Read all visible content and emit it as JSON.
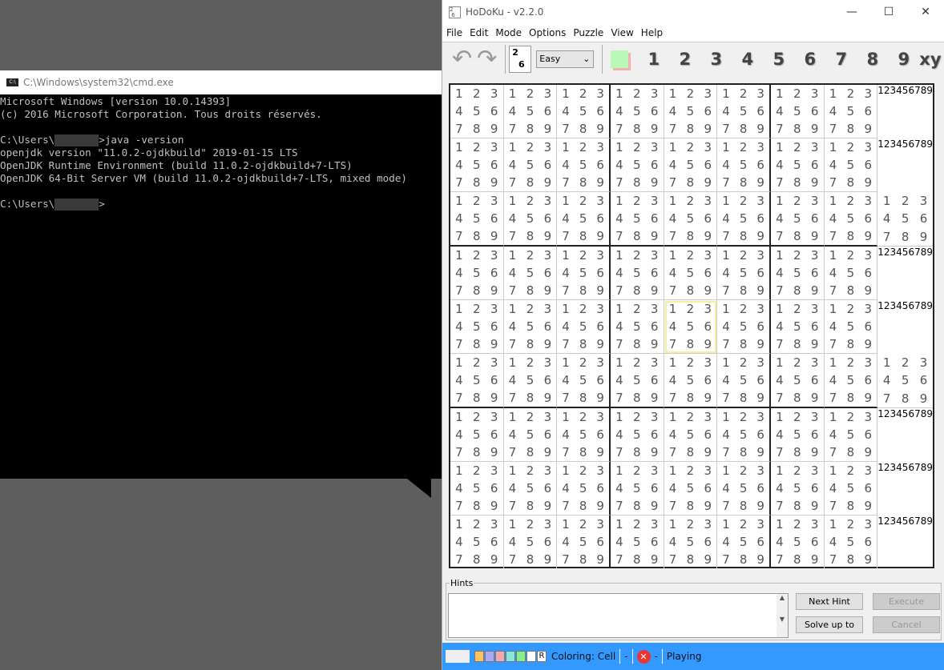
{
  "cmd": {
    "title": "C:\\Windows\\system32\\cmd.exe",
    "icon": "cmd-icon",
    "lines": [
      "Microsoft Windows [version 10.0.14393]",
      "(c) 2016 Microsoft Corporation. Tous droits réservés.",
      "",
      "C:\\Users\\",
      "openjdk version \"11.0.2-ojdkbuild\" 2019-01-15 LTS",
      "OpenJDK Runtime Environment (build 11.0.2-ojdkbuild+7-LTS)",
      "OpenJDK 64-Bit Server VM (build 11.0.2-ojdkbuild+7-LTS, mixed mode)",
      "",
      "C:\\Users\\"
    ],
    "cmd_suffix": ">java -version",
    "prompt_suffix": ">"
  },
  "app": {
    "title": "HoDoKu - v2.2.0",
    "menu": [
      "File",
      "Edit",
      "Mode",
      "Options",
      "Puzzle",
      "View",
      "Help"
    ],
    "difficulty": "Easy",
    "digits": [
      "1",
      "2",
      "3",
      "4",
      "5",
      "6",
      "7",
      "8",
      "9"
    ],
    "xy_label": "xy",
    "candidates": [
      "1",
      "2",
      "3",
      "4",
      "5",
      "6",
      "7",
      "8",
      "9"
    ],
    "selected_cell": {
      "row": 5,
      "col": 5
    },
    "hints": {
      "label": "Hints",
      "next_hint": "Next Hint",
      "execute": "Execute",
      "solve_up_to": "Solve up to",
      "cancel": "Cancel"
    },
    "status": {
      "colors": [
        "#ffc060",
        "#b0a8f0",
        "#f4a8a8",
        "#88e8d8",
        "#88f088",
        "#ffffff"
      ],
      "reset": "R",
      "coloring": "Coloring: Cell",
      "dash1": "-",
      "dash2": "-",
      "state": "Playing",
      "accent": "#3399ff"
    }
  }
}
